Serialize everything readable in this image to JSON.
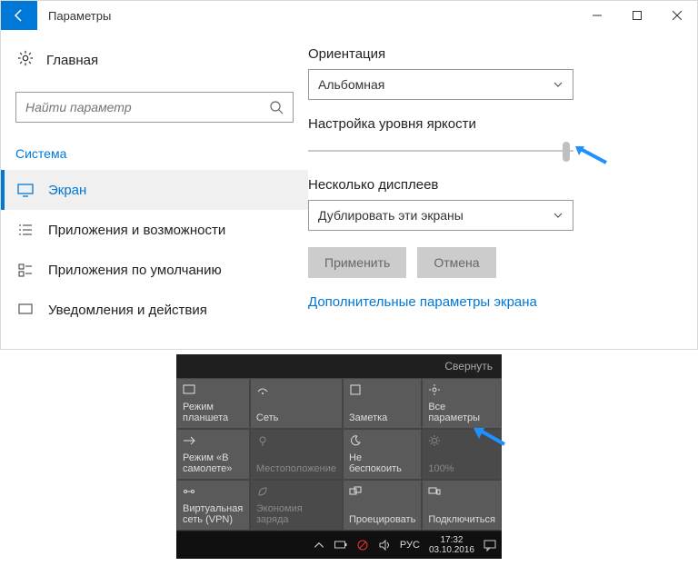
{
  "window": {
    "title": "Параметры"
  },
  "sidebar": {
    "home": "Главная",
    "search_placeholder": "Найти параметр",
    "category": "Система",
    "items": [
      {
        "label": "Экран"
      },
      {
        "label": "Приложения и возможности"
      },
      {
        "label": "Приложения по умолчанию"
      },
      {
        "label": "Уведомления и действия"
      }
    ]
  },
  "content": {
    "orientation_label": "Ориентация",
    "orientation_value": "Альбомная",
    "brightness_label": "Настройка уровня яркости",
    "multi_display_label": "Несколько дисплеев",
    "multi_display_value": "Дублировать эти экраны",
    "apply": "Применить",
    "cancel": "Отмена",
    "advanced_link": "Дополнительные параметры экрана"
  },
  "action_center": {
    "collapse": "Свернуть",
    "tiles": [
      {
        "label": "Режим планшета"
      },
      {
        "label": "Сеть"
      },
      {
        "label": "Заметка"
      },
      {
        "label": "Все параметры"
      },
      {
        "label": "Режим «В самолете»"
      },
      {
        "label": "Местоположение"
      },
      {
        "label": "Не беспокоить"
      },
      {
        "label": "100%"
      },
      {
        "label": "Виртуальная сеть (VPN)"
      },
      {
        "label": "Экономия заряда"
      },
      {
        "label": "Проецировать"
      },
      {
        "label": "Подключиться"
      }
    ]
  },
  "taskbar": {
    "lang": "РУС",
    "time": "17:32",
    "date": "03.10.2016"
  }
}
